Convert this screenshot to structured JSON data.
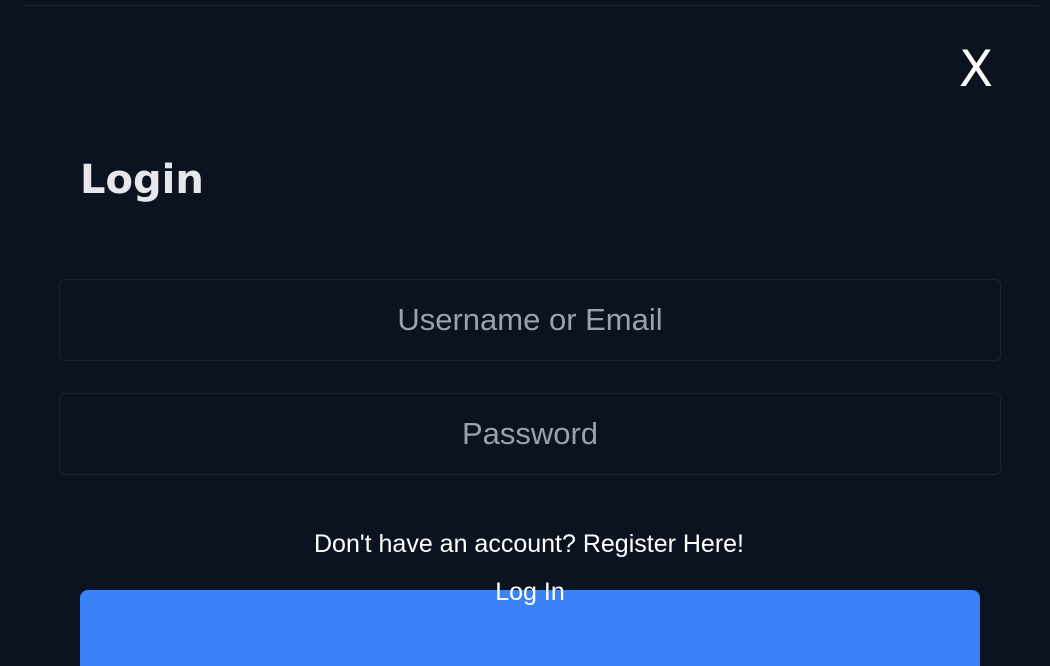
{
  "modal": {
    "close_label": "X",
    "title": "Login",
    "username_placeholder": "Username or Email",
    "password_placeholder": "Password",
    "register_prompt": "Don't have an account? Register Here!",
    "login_label": "Log In"
  },
  "colors": {
    "background": "#0b1220",
    "accent": "#3b82f6",
    "field_border": "#1a2230",
    "placeholder": "#9aa1ad",
    "text": "#ffffff"
  },
  "icons": {
    "close": "close-icon"
  }
}
